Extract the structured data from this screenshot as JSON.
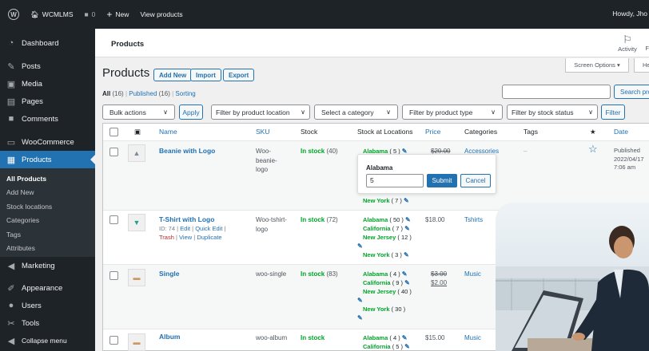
{
  "adminbar": {
    "site": "WCMLMS",
    "comments": "0",
    "new": "New",
    "view": "View products",
    "howdy": "Howdy, Jho"
  },
  "sidebar": {
    "items": [
      {
        "label": "Dashboard"
      },
      {
        "label": "Posts"
      },
      {
        "label": "Media"
      },
      {
        "label": "Pages"
      },
      {
        "label": "Comments"
      },
      {
        "label": "WooCommerce"
      },
      {
        "label": "Products"
      }
    ],
    "submenu": [
      "All Products",
      "Add New",
      "Stock locations",
      "Categories",
      "Tags",
      "Attributes"
    ],
    "items2": [
      {
        "label": "Marketing"
      },
      {
        "label": "Appearance"
      },
      {
        "label": "Users"
      },
      {
        "label": "Tools"
      },
      {
        "label": "Collapse menu"
      }
    ]
  },
  "topstrip": {
    "title": "Products",
    "activity": "Activity",
    "f": "F"
  },
  "header": {
    "title": "Products",
    "add_new": "Add New",
    "import": "Import",
    "export": "Export",
    "screen_options": "Screen Options ▾",
    "help": "He"
  },
  "views": {
    "all": "All",
    "all_count": "(16)",
    "published": "Published",
    "published_count": "(16)",
    "sorting": "Sorting",
    "sep": "|"
  },
  "search": {
    "button": "Search pro",
    "value": ""
  },
  "filters": {
    "bulk": "Bulk actions",
    "apply": "Apply",
    "location": "Filter by product location",
    "category": "Select a category",
    "type": "Filter by product type",
    "stock": "Filter by stock status",
    "filter": "Filter"
  },
  "columns": {
    "name": "Name",
    "sku": "SKU",
    "stock": "Stock",
    "stock_locations": "Stock at Locations",
    "price": "Price",
    "categories": "Categories",
    "tags": "Tags",
    "date": "Date",
    "star": "★"
  },
  "rows": [
    {
      "name": "Beanie with Logo",
      "sku": "Woo-beanie-logo",
      "stock": "In stock",
      "stock_count": "(40)",
      "locations": [
        {
          "name": "Alabama",
          "count": "( 5 )"
        },
        {
          "name": "New York",
          "count": "( 7 )"
        }
      ],
      "price_old": "$20.00",
      "price_new": "",
      "category": "Accessories",
      "tags": "–",
      "date_status": "Published",
      "date": "2022/04/17",
      "time": "7:06 am"
    },
    {
      "name": "T-Shirt with Logo",
      "meta": "ID: 74 |",
      "edit": "Edit",
      "quick_edit": "Quick Edit",
      "sep": "|",
      "trash": "Trash",
      "view": "View",
      "duplicate": "Duplicate",
      "sku": "Woo-tshirt-logo",
      "stock": "In stock",
      "stock_count": "(72)",
      "locations": [
        {
          "name": "Alabama",
          "count": "( 50 )"
        },
        {
          "name": "California",
          "count": "( 7 )"
        },
        {
          "name": "New Jersey",
          "count": "( 12 )"
        },
        {
          "name": "New York",
          "count": "( 3 )"
        }
      ],
      "price_old": "",
      "price_new": "$18.00",
      "category": "Tshirts"
    },
    {
      "name": "Single",
      "sku": "woo-single",
      "stock": "In stock",
      "stock_count": "(83)",
      "locations": [
        {
          "name": "Alabama",
          "count": "( 4 )"
        },
        {
          "name": "California",
          "count": "( 9 )"
        },
        {
          "name": "New Jersey",
          "count": "( 40 )"
        },
        {
          "name": "New York",
          "count": "( 30 )"
        }
      ],
      "price_old": "$3.00",
      "price_new": "$2.00",
      "category": "Music"
    },
    {
      "name": "Album",
      "sku": "woo-album",
      "stock": "In stock",
      "stock_count": "",
      "locations": [
        {
          "name": "Alabama",
          "count": "( 4 )"
        },
        {
          "name": "California",
          "count": "( 5 )"
        }
      ],
      "price_old": "",
      "price_new": "$15.00",
      "category": "Music"
    }
  ],
  "popup": {
    "label": "Alabama",
    "value": "5",
    "submit": "Submit",
    "cancel": "Cancel"
  },
  "colors": {
    "accent": "#2271b1",
    "sidebar": "#1d2327",
    "in_stock": "#00a32a",
    "trash": "#b32d2e"
  }
}
